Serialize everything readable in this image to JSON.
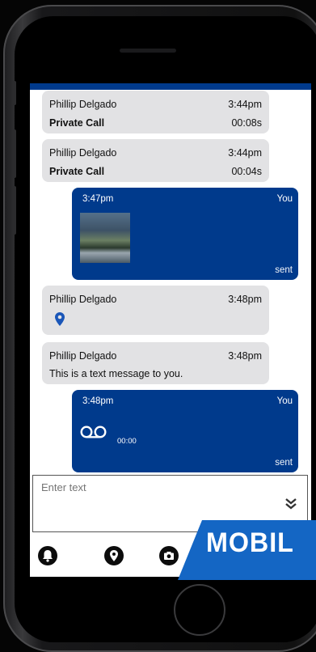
{
  "messages": [
    {
      "sender": "Phillip Delgado",
      "time": "3:44pm",
      "label": "Private Call",
      "duration": "00:08s"
    },
    {
      "sender": "Phillip Delgado",
      "time": "3:44pm",
      "label": "Private Call",
      "duration": "00:04s"
    },
    {
      "time": "3:47pm",
      "author": "You",
      "status": "sent"
    },
    {
      "sender": "Phillip Delgado",
      "time": "3:48pm"
    },
    {
      "sender": "Phillip Delgado",
      "time": "3:48pm",
      "text": "This is a text message to you."
    },
    {
      "time": "3:48pm",
      "author": "You",
      "voice_duration": "00:00",
      "status": "sent"
    }
  ],
  "input": {
    "placeholder": "Enter text"
  },
  "icons": {
    "expand": "double-chevron-down-icon",
    "alert": "alert-icon",
    "location": "location-pin-icon",
    "camera": "camera-icon",
    "voicemail": "voicemail-icon"
  },
  "banner": {
    "text": "MOBIL"
  },
  "colors": {
    "accent": "#003a8c",
    "bubble": "#e2e2e4",
    "banner": "#1466c4"
  }
}
